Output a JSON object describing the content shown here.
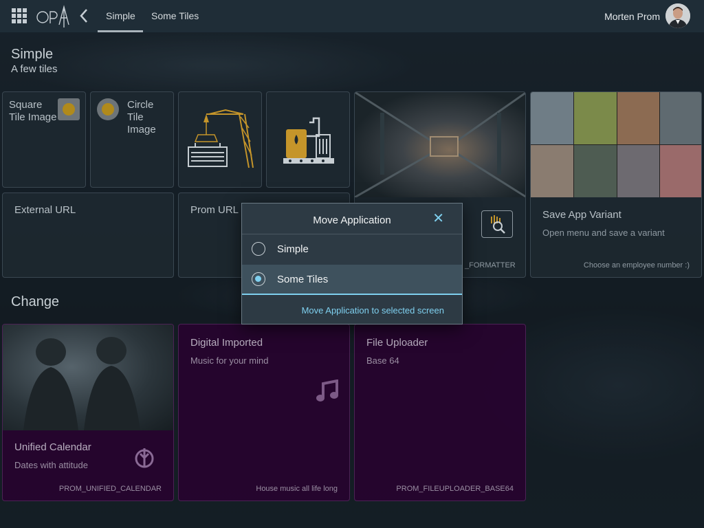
{
  "shell": {
    "logo_text": "OPA",
    "tabs": [
      {
        "label": "Simple",
        "active": true
      },
      {
        "label": "Some Tiles",
        "active": false
      }
    ],
    "user_name": "Morten Prom",
    "accent": "#7fd0ef"
  },
  "section1": {
    "title": "Simple",
    "subtitle": "A few tiles"
  },
  "section2": {
    "title": "Change"
  },
  "tiles": {
    "square": {
      "title": "Square Tile Image"
    },
    "circle": {
      "title": "Circle Tile Image"
    },
    "external": {
      "title": "External URL"
    },
    "prom": {
      "title": "Prom URL"
    },
    "formatter": {
      "footer": "_FORMATTER"
    },
    "save_variant": {
      "title": "Save App Variant",
      "subtitle": "Open menu and save a variant",
      "footer": "Choose an employee number :)"
    },
    "calendar": {
      "title": "Unified Calendar",
      "subtitle": "Dates with attitude",
      "footer": "PROM_UNIFIED_CALENDAR"
    },
    "digital": {
      "title": "Digital Imported",
      "subtitle": "Music for your mind",
      "footer": "House music all life long"
    },
    "uploader": {
      "title": "File Uploader",
      "subtitle": "Base 64",
      "footer": "PROM_FILEUPLOADER_BASE64"
    }
  },
  "dialog": {
    "title": "Move Application",
    "options": [
      {
        "label": "Simple",
        "selected": false
      },
      {
        "label": "Some Tiles",
        "selected": true
      }
    ],
    "action": "Move Application to selected screen"
  }
}
